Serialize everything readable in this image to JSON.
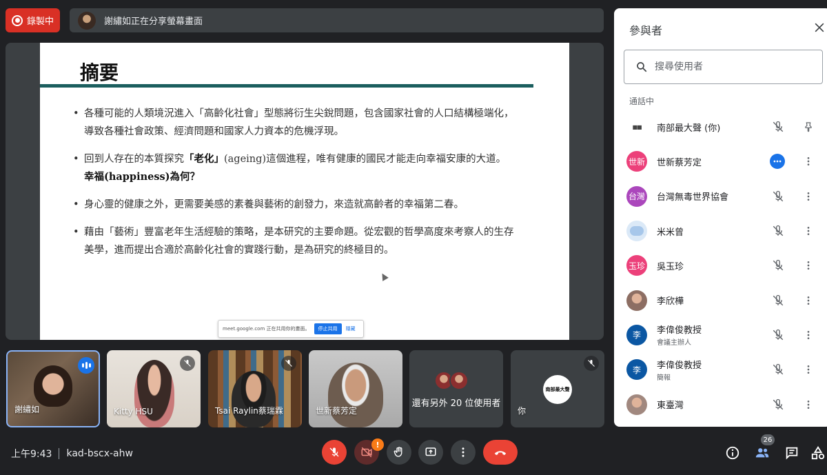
{
  "top": {
    "recording_label": "錄製中",
    "share_banner": "謝繡如正在分享螢幕畫面"
  },
  "slide": {
    "title": "摘要",
    "bullets": [
      {
        "pre": "各種可能的人類境況進入「高齡化社會」型態將衍生尖銳問題，包含國家社會的人口結構極端化，導致各種社會政策、經濟問題和國家人力資本的危機浮現。",
        "bold": "",
        "post": ""
      },
      {
        "pre": "回到人存在的本質探究",
        "bold": "「老化」",
        "post": "(ageing)這個進程，唯有健康的國民才能走向幸福安康的大道。",
        "bold2": "幸福(happiness)為何？"
      },
      {
        "pre": "身心靈的健康之外，更需要美感的素養與藝術的創發力，來造就高齡者的幸福第二春。",
        "bold": "",
        "post": ""
      },
      {
        "pre": "藉由「藝術」豐富老年生活經驗的策略，是本研究的主要命題。從宏觀的哲學高度來考察人的生存美學，進而提出合適於高齡化社會的實踐行動，是為研究的終極目的。",
        "bold": "",
        "post": ""
      }
    ],
    "share_popup": {
      "text": "meet.google.com 正在共用你的畫面。",
      "stop_label": "停止共用",
      "hide_label": "隱藏"
    }
  },
  "tiles": [
    {
      "name": "謝繡如",
      "speaking": true
    },
    {
      "name": "Kitty HSU",
      "muted": true
    },
    {
      "name": "Tsai Raylin蔡瑞霖",
      "muted": true
    },
    {
      "name": "世新蔡芳定",
      "muted": false
    },
    {
      "name": "",
      "more_label": "還有另外 20 位使用者"
    },
    {
      "name": "你",
      "muted": true,
      "logo_text": "南部最大聲"
    }
  ],
  "bottom": {
    "time": "上午9:43",
    "meeting_code": "kad-bscx-ahw",
    "warning_badge": "!",
    "participant_count": "26"
  },
  "panel": {
    "title": "參與者",
    "search_placeholder": "搜尋使用者",
    "section_label": "通話中",
    "participants": [
      {
        "name": "南部最大聲 (你)",
        "sub": "",
        "avatar": "",
        "color": "#ffffff"
      },
      {
        "name": "世新蔡芳定",
        "sub": "",
        "avatar": "世新",
        "color": "#ec407a"
      },
      {
        "name": "台灣無毒世界協會",
        "sub": "",
        "avatar": "台灣",
        "color": "#ab47bc"
      },
      {
        "name": "米米曾",
        "sub": "",
        "avatar": "",
        "color": "#dbe9f7"
      },
      {
        "name": "吳玉珍",
        "sub": "",
        "avatar": "玉珍",
        "color": "#ec407a"
      },
      {
        "name": "李欣樺",
        "sub": "",
        "avatar": "",
        "color": "#8d6e63"
      },
      {
        "name": "李偉俊教授",
        "sub": "會議主辦人",
        "avatar": "李",
        "color": "#0b57a3"
      },
      {
        "name": "李偉俊教授",
        "sub": "簡報",
        "avatar": "李",
        "color": "#0b57a3"
      },
      {
        "name": "東臺灣",
        "sub": "",
        "avatar": "",
        "color": "#a1887f"
      }
    ]
  },
  "colors": {
    "accent": "#1a73e8",
    "danger": "#ea4335",
    "slide_rule": "#1b5e5e"
  }
}
